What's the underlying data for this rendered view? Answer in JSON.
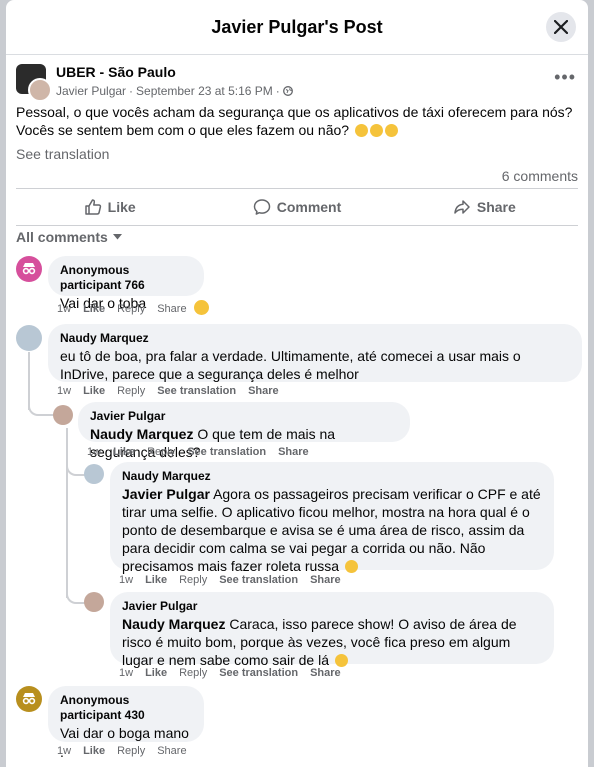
{
  "header": {
    "title": "Javier Pulgar's Post",
    "close_label": "×"
  },
  "post": {
    "group_name": "UBER - São Paulo",
    "author": "Javier Pulgar",
    "date": "September 23 at 5:16 PM",
    "separator": "·",
    "more_label": "•••",
    "text": "Pessoal, o que vocês acham da segurança que os aplicativos de táxi oferecem para nós? Vocês se sentem bem com o que eles fazem ou não?",
    "see_translation": "See translation",
    "comment_count": "6 comments"
  },
  "actions": {
    "like": "Like",
    "comment": "Comment",
    "share": "Share"
  },
  "filter": {
    "label": "All comments"
  },
  "comments": [
    {
      "author": "Anonymous participant 766",
      "text": "Vai dar o toba",
      "time": "1w",
      "like": "Like",
      "reply": "Reply",
      "share": "Share"
    },
    {
      "author": "Naudy Marquez",
      "text": "eu tô de boa, pra falar a verdade. Ultimamente, até comecei a usar mais o InDrive, parece que a segurança deles é melhor",
      "time": "1w",
      "like": "Like",
      "reply": "Reply",
      "see_translation": "See translation",
      "share": "Share"
    },
    {
      "author": "Javier Pulgar",
      "mention": "Naudy Marquez",
      "text": "O que tem de mais na segurança deles?",
      "time": "1w",
      "like": "Like",
      "reply": "Reply",
      "see_translation": "See translation",
      "share": "Share"
    },
    {
      "author": "Naudy Marquez",
      "mention": "Javier Pulgar",
      "text": "Agora os passageiros precisam verificar o CPF e até tirar uma selfie. O aplicativo ficou melhor, mostra na hora qual é o ponto de desembarque e avisa se é uma área de risco, assim da para decidir com calma se vai pegar a corrida ou não. Não precisamos mais fazer roleta russa",
      "time": "1w",
      "like": "Like",
      "reply": "Reply",
      "see_translation": "See translation",
      "share": "Share"
    },
    {
      "author": "Javier Pulgar",
      "mention": "Naudy Marquez",
      "text": "Caraca, isso parece show! O aviso de área de risco é muito bom, porque às vezes, você fica preso em algum lugar e nem sabe como sair de lá",
      "time": "1w",
      "like": "Like",
      "reply": "Reply",
      "see_translation": "See translation",
      "share": "Share"
    },
    {
      "author": "Anonymous participant 430",
      "text": "Vai dar o boga mano",
      "text2": ".",
      "time": "1w",
      "like": "Like",
      "reply": "Reply",
      "share": "Share"
    }
  ]
}
